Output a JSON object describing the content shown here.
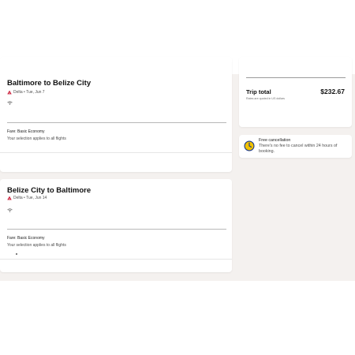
{
  "flights": [
    {
      "route": "Baltimore to Belize City",
      "airline_date": "Delta • Tue, Jun 7",
      "fare": "Fare: Basic Economy",
      "note": "Your selection applies to all flights"
    },
    {
      "route": "Belize City to Baltimore",
      "airline_date": "Delta • Tue, Jun 14",
      "fare": "Fare: Basic Economy",
      "note": "Your selection applies to all flights"
    }
  ],
  "summary": {
    "trip_total_label": "Trip total",
    "trip_total_amount": "$232.67",
    "currency_note": "Rates are quoted in US dollars"
  },
  "cancellation": {
    "title": "Free cancellation",
    "body": "There's no fee to cancel within 24 hours of booking."
  },
  "colors": {
    "accent": "#1b3a8c",
    "clock_yellow": "#f2c200",
    "airline_red": "#c8102e",
    "page_band": "#f4f1ef"
  },
  "icons": {
    "airline": "delta-logo-icon",
    "wifi": "wifi-icon",
    "cancellation": "clock-icon"
  }
}
